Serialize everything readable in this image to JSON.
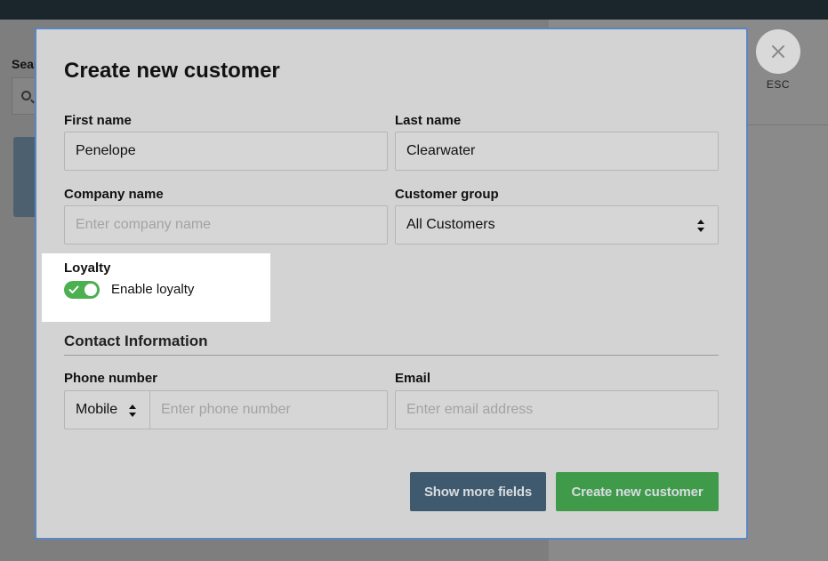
{
  "background": {
    "search_label": "Sear"
  },
  "close": {
    "label": "ESC",
    "icon": "close-icon"
  },
  "modal": {
    "title": "Create new customer",
    "first_name": {
      "label": "First name",
      "value": "Penelope"
    },
    "last_name": {
      "label": "Last name",
      "value": "Clearwater"
    },
    "company_name": {
      "label": "Company name",
      "placeholder": "Enter company name"
    },
    "customer_group": {
      "label": "Customer group",
      "value": "All Customers"
    },
    "loyalty": {
      "label": "Loyalty",
      "toggle_label": "Enable loyalty",
      "enabled": true
    },
    "contact_section": "Contact Information",
    "phone": {
      "label": "Phone number",
      "type_value": "Mobile",
      "placeholder": "Enter phone number"
    },
    "email": {
      "label": "Email",
      "placeholder": "Enter email address"
    },
    "buttons": {
      "show_more": "Show more fields",
      "create": "Create new customer"
    }
  },
  "colors": {
    "accent_green": "#3f9a4a",
    "secondary_button": "#3f5a6e",
    "modal_border": "#5a86c4"
  }
}
